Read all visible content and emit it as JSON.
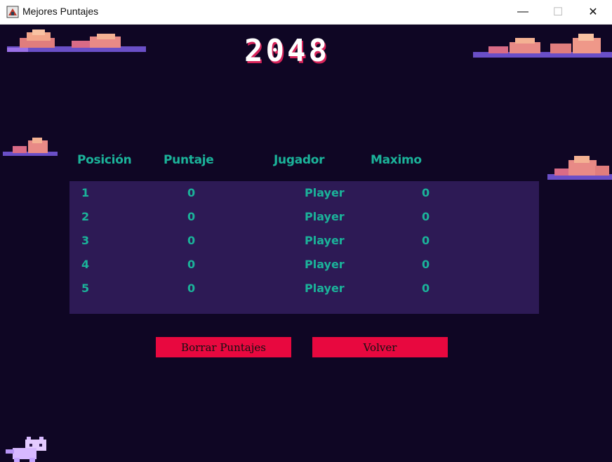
{
  "window": {
    "title": "Mejores Puntajes",
    "minimize_glyph": "—",
    "maximize_glyph": "☐",
    "close_glyph": "✕"
  },
  "game": {
    "logo_text": "2048",
    "logo_color": "#ffffff",
    "logo_shadow": "#d6245a"
  },
  "table": {
    "headers": [
      "Posición",
      "Puntaje",
      "Jugador",
      "Maximo"
    ],
    "rows": [
      {
        "pos": "1",
        "score": "0",
        "player": "Player",
        "max": "0"
      },
      {
        "pos": "2",
        "score": "0",
        "player": "Player",
        "max": "0"
      },
      {
        "pos": "3",
        "score": "0",
        "player": "Player",
        "max": "0"
      },
      {
        "pos": "4",
        "score": "0",
        "player": "Player",
        "max": "0"
      },
      {
        "pos": "5",
        "score": "0",
        "player": "Player",
        "max": "0"
      }
    ]
  },
  "buttons": {
    "clear": "Borrar Puntajes",
    "back": "Volver"
  },
  "colors": {
    "background": "#0f0624",
    "panel": "#2d1a55",
    "text_accent": "#1bb39a",
    "button": "#e8083f"
  }
}
